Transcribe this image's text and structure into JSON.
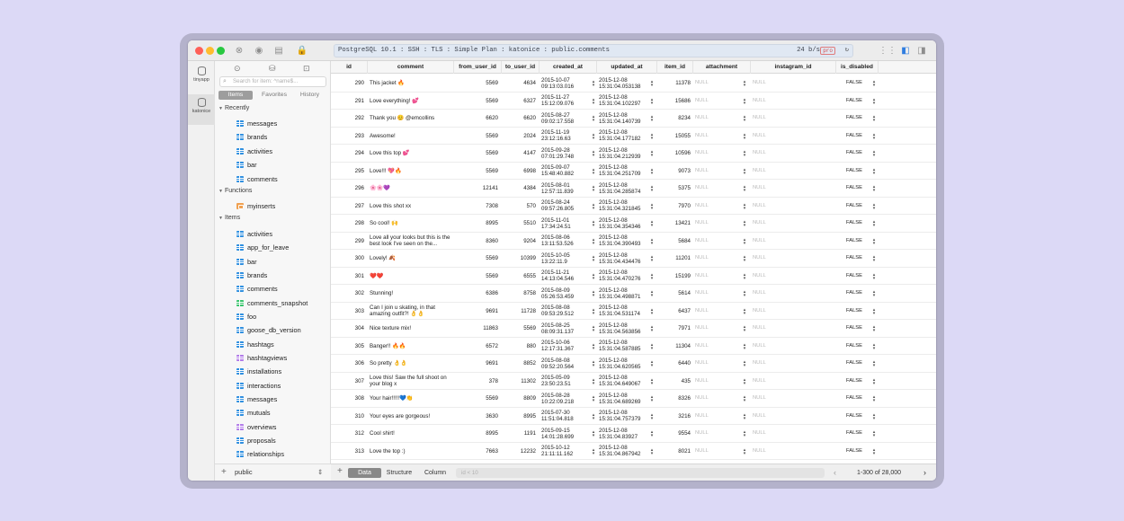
{
  "titlebar": {
    "connection": "PostgreSQL 10.1 : SSH : TLS : Simple Plan : katonice : public.comments",
    "speed": "24 b/s",
    "badge": "pro",
    "refresh_icon": "refresh-icon",
    "colors": {
      "close": "#fe5f57",
      "minimize": "#febc2e",
      "maximize": "#28c840"
    }
  },
  "rail": {
    "items": [
      {
        "label": "tinyapp",
        "icon": "database-icon"
      },
      {
        "label": "katonice",
        "icon": "database-icon"
      }
    ]
  },
  "sidebar": {
    "search_placeholder": "Search for item: ^name$...",
    "segments": [
      "Items",
      "Favorites",
      "History"
    ],
    "sections": {
      "recent": "Recently",
      "functions": "Functions",
      "items": "Items"
    },
    "recent_items": [
      "messages",
      "brands",
      "activities",
      "bar",
      "comments"
    ],
    "function_items": [
      "myinserts"
    ],
    "item_list": [
      "activities",
      "app_for_leave",
      "bar",
      "brands",
      "comments",
      "comments_snapshot",
      "foo",
      "goose_db_version",
      "hashtags",
      "hashtagviews",
      "installations",
      "interactions",
      "messages",
      "mutuals",
      "overviews",
      "proposals",
      "relationships"
    ],
    "schema": "public",
    "add": "+"
  },
  "grid": {
    "columns": [
      "id",
      "comment",
      "from_user_id",
      "to_user_id",
      "created_at",
      "updated_at",
      "item_id",
      "attachment",
      "instagram_id",
      "is_disabled"
    ],
    "rows": [
      {
        "id": "290",
        "comment": "This jacket 🔥",
        "from": "5569",
        "to": "4634",
        "created": [
          "2015-10-07",
          "09:13:03.016"
        ],
        "updated": [
          "2015-12-08",
          "15:31:04.053138"
        ],
        "item": "11378",
        "attachment": "NULL",
        "instagram": "NULL",
        "disabled": "FALSE"
      },
      {
        "id": "291",
        "comment": "Love everything! 💕",
        "from": "5569",
        "to": "6327",
        "created": [
          "2015-11-27",
          "15:12:09.076"
        ],
        "updated": [
          "2015-12-08",
          "15:31:04.102297"
        ],
        "item": "15686",
        "attachment": "NULL",
        "instagram": "NULL",
        "disabled": "FALSE"
      },
      {
        "id": "292",
        "comment": "Thank you 😊 @emcollins",
        "from": "6620",
        "to": "6620",
        "created": [
          "2015-08-27",
          "09:02:17.558"
        ],
        "updated": [
          "2015-12-08",
          "15:31:04.140739"
        ],
        "item": "8234",
        "attachment": "NULL",
        "instagram": "NULL",
        "disabled": "FALSE"
      },
      {
        "id": "293",
        "comment": "Awesome!",
        "from": "5569",
        "to": "2024",
        "created": [
          "2015-11-19",
          "23:12:16.63"
        ],
        "updated": [
          "2015-12-08",
          "15:31:04.177182"
        ],
        "item": "15055",
        "attachment": "NULL",
        "instagram": "NULL",
        "disabled": "FALSE"
      },
      {
        "id": "294",
        "comment": "Love this top 💕",
        "from": "5569",
        "to": "4147",
        "created": [
          "2015-09-28",
          "07:01:29.748"
        ],
        "updated": [
          "2015-12-08",
          "15:31:04.212939"
        ],
        "item": "10596",
        "attachment": "NULL",
        "instagram": "NULL",
        "disabled": "FALSE"
      },
      {
        "id": "295",
        "comment": "Love!!! 💖🔥",
        "from": "5569",
        "to": "6998",
        "created": [
          "2015-09-07",
          "15:48:40.882"
        ],
        "updated": [
          "2015-12-08",
          "15:31:04.251709"
        ],
        "item": "9073",
        "attachment": "NULL",
        "instagram": "NULL",
        "disabled": "FALSE"
      },
      {
        "id": "296",
        "comment": "🌸🌸💜",
        "from": "12141",
        "to": "4384",
        "created": [
          "2015-08-01",
          "12:57:11.839"
        ],
        "updated": [
          "2015-12-08",
          "15:31:04.285874"
        ],
        "item": "5375",
        "attachment": "NULL",
        "instagram": "NULL",
        "disabled": "FALSE"
      },
      {
        "id": "297",
        "comment": "Love this shot xx",
        "from": "7308",
        "to": "570",
        "created": [
          "2015-08-24",
          "09:57:26.805"
        ],
        "updated": [
          "2015-12-08",
          "15:31:04.321845"
        ],
        "item": "7970",
        "attachment": "NULL",
        "instagram": "NULL",
        "disabled": "FALSE"
      },
      {
        "id": "298",
        "comment": "So cool! 🙌",
        "from": "8995",
        "to": "5510",
        "created": [
          "2015-11-01",
          "17:34:24.51"
        ],
        "updated": [
          "2015-12-08",
          "15:31:04.354346"
        ],
        "item": "13421",
        "attachment": "NULL",
        "instagram": "NULL",
        "disabled": "FALSE"
      },
      {
        "id": "299",
        "comment": "Love all your looks but this is the best look I've seen on the...",
        "from": "8360",
        "to": "9204",
        "created": [
          "2015-08-06",
          "13:11:53.526"
        ],
        "updated": [
          "2015-12-08",
          "15:31:04.390493"
        ],
        "item": "5684",
        "attachment": "NULL",
        "instagram": "NULL",
        "disabled": "FALSE"
      },
      {
        "id": "300",
        "comment": "Lovely! 🍂",
        "from": "5569",
        "to": "10399",
        "created": [
          "2015-10-05",
          "13:22:11.9"
        ],
        "updated": [
          "2015-12-08",
          "15:31:04.434476"
        ],
        "item": "11201",
        "attachment": "NULL",
        "instagram": "NULL",
        "disabled": "FALSE"
      },
      {
        "id": "301",
        "comment": "❤️❤️",
        "from": "5569",
        "to": "6555",
        "created": [
          "2015-11-21",
          "14:13:04.546"
        ],
        "updated": [
          "2015-12-08",
          "15:31:04.470276"
        ],
        "item": "15199",
        "attachment": "NULL",
        "instagram": "NULL",
        "disabled": "FALSE"
      },
      {
        "id": "302",
        "comment": "Stunning!",
        "from": "6386",
        "to": "8758",
        "created": [
          "2015-08-09",
          "05:26:53.459"
        ],
        "updated": [
          "2015-12-08",
          "15:31:04.498871"
        ],
        "item": "5614",
        "attachment": "NULL",
        "instagram": "NULL",
        "disabled": "FALSE"
      },
      {
        "id": "303",
        "comment": "Can I join u skating, in that amazing outfit?! 👌👌",
        "from": "9691",
        "to": "11728",
        "created": [
          "2015-08-08",
          "09:53:29.512"
        ],
        "updated": [
          "2015-12-08",
          "15:31:04.531174"
        ],
        "item": "6437",
        "attachment": "NULL",
        "instagram": "NULL",
        "disabled": "FALSE"
      },
      {
        "id": "304",
        "comment": "Nice texture mix!",
        "from": "11863",
        "to": "5569",
        "created": [
          "2015-08-25",
          "08:09:31.137"
        ],
        "updated": [
          "2015-12-08",
          "15:31:04.563856"
        ],
        "item": "7971",
        "attachment": "NULL",
        "instagram": "NULL",
        "disabled": "FALSE"
      },
      {
        "id": "305",
        "comment": "Banger!! 🔥🔥",
        "from": "6572",
        "to": "880",
        "created": [
          "2015-10-06",
          "12:17:31.367"
        ],
        "updated": [
          "2015-12-08",
          "15:31:04.587885"
        ],
        "item": "11304",
        "attachment": "NULL",
        "instagram": "NULL",
        "disabled": "FALSE"
      },
      {
        "id": "306",
        "comment": "So pretty 👌👌",
        "from": "9691",
        "to": "8852",
        "created": [
          "2015-08-08",
          "09:52:20.564"
        ],
        "updated": [
          "2015-12-08",
          "15:31:04.620565"
        ],
        "item": "6440",
        "attachment": "NULL",
        "instagram": "NULL",
        "disabled": "FALSE"
      },
      {
        "id": "307",
        "comment": "Love this! Saw the full shoot on your blog x",
        "from": "378",
        "to": "11302",
        "created": [
          "2015-05-09",
          "23:50:23.51"
        ],
        "updated": [
          "2015-12-08",
          "15:31:04.649067"
        ],
        "item": "435",
        "attachment": "NULL",
        "instagram": "NULL",
        "disabled": "FALSE"
      },
      {
        "id": "308",
        "comment": "Your hair!!!!!💙👏",
        "from": "5569",
        "to": "8809",
        "created": [
          "2015-08-28",
          "10:22:09.218"
        ],
        "updated": [
          "2015-12-08",
          "15:31:04.689269"
        ],
        "item": "8326",
        "attachment": "NULL",
        "instagram": "NULL",
        "disabled": "FALSE"
      },
      {
        "id": "310",
        "comment": "Your eyes are gorgeous!",
        "from": "3630",
        "to": "8995",
        "created": [
          "2015-07-30",
          "11:51:04.818"
        ],
        "updated": [
          "2015-12-08",
          "15:31:04.757379"
        ],
        "item": "3216",
        "attachment": "NULL",
        "instagram": "NULL",
        "disabled": "FALSE"
      },
      {
        "id": "312",
        "comment": "Cool shirt!",
        "from": "8995",
        "to": "1191",
        "created": [
          "2015-09-15",
          "14:01:28.699"
        ],
        "updated": [
          "2015-12-08",
          "15:31:04.83927"
        ],
        "item": "9554",
        "attachment": "NULL",
        "instagram": "NULL",
        "disabled": "FALSE"
      },
      {
        "id": "313",
        "comment": "Love the top :)",
        "from": "7663",
        "to": "12232",
        "created": [
          "2015-10-12",
          "21:11:11.162"
        ],
        "updated": [
          "2015-12-08",
          "15:31:04.867942"
        ],
        "item": "8021",
        "attachment": "NULL",
        "instagram": "NULL",
        "disabled": "FALSE"
      }
    ]
  },
  "bottombar": {
    "add": "+",
    "tabs": [
      "Data",
      "Structure",
      "Column"
    ],
    "filter_placeholder": "id < 10",
    "pagination": "1-300 of 28,000",
    "prev": "‹",
    "next": "›"
  }
}
